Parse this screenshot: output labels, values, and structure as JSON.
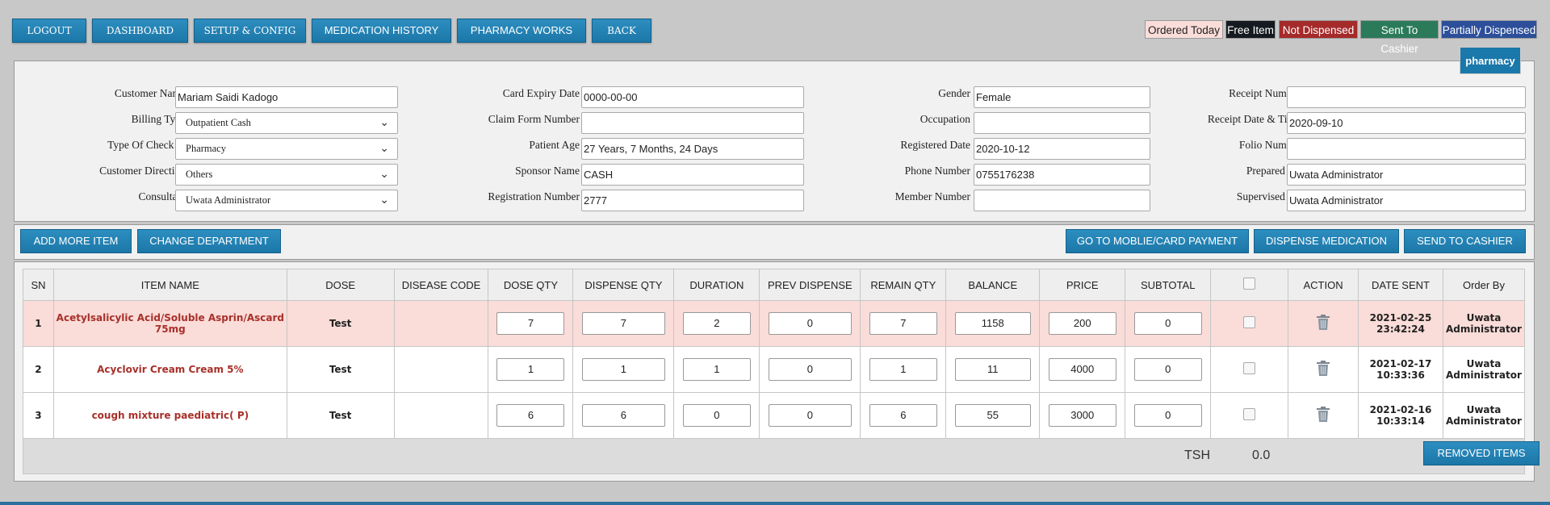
{
  "nav": {
    "logout": "LOGOUT",
    "dashboard": "DASHBOARD",
    "setup": "SETUP & CONFIG",
    "medication_history": "MEDICATION HISTORY",
    "pharmacy_works": "PHARMACY WORKS",
    "back": "BACK"
  },
  "legend": {
    "ordered_today": "Ordered Today",
    "free_item": "Free Item",
    "not_dispensed": "Not Dispensed",
    "sent_to_cashier": "Sent To Cashier",
    "partially_dispensed": "Partially Dispensed",
    "colors": {
      "ordered_today": "#fadcd8",
      "free_item": "#141a1f",
      "not_dispensed": "#a52a2a",
      "sent_to_cashier": "#2b7a5a",
      "partially_dispensed": "#2d4f9a"
    }
  },
  "pharmacy_button": "pharmacy",
  "form": {
    "customer_name_label": "Customer Name",
    "customer_name": "Mariam Saidi Kadogo",
    "billing_type_label": "Billing Type",
    "billing_type": "Outpatient Cash",
    "type_of_check_in_label": "Type Of Check In",
    "type_of_check_in": "Pharmacy",
    "customer_direction_label": "Customer Direction",
    "customer_direction": "Others",
    "consultant_label": "Consultant",
    "consultant": "Uwata Administrator",
    "card_expiry_label": "Card Expiry Date",
    "card_expiry": "0000-00-00",
    "claim_form_label": "Claim Form Number",
    "claim_form": "",
    "patient_age_label": "Patient Age",
    "patient_age": "27 Years, 7 Months, 24 Days",
    "sponsor_name_label": "Sponsor Name",
    "sponsor_name": "CASH",
    "registration_number_label": "Registration Number",
    "registration_number": "2777",
    "gender_label": "Gender",
    "gender": "Female",
    "occupation_label": "Occupation",
    "occupation": "",
    "registered_date_label": "Registered Date",
    "registered_date": "2020-10-12",
    "phone_label": "Phone Number",
    "phone": "0755176238",
    "member_number_label": "Member Number",
    "member_number": "",
    "receipt_number_label": "Receipt Number",
    "receipt_number": "",
    "receipt_datetime_label": "Receipt Date & Time",
    "receipt_datetime": "2020-09-10",
    "folio_label": "Folio Number",
    "folio": "",
    "prepared_by_label": "Prepared By",
    "prepared_by": "Uwata Administrator",
    "supervised_by_label": "Supervised By",
    "supervised_by": "Uwata Administrator"
  },
  "actions": {
    "add_more_item": "ADD MORE ITEM",
    "change_department": "CHANGE DEPARTMENT",
    "go_to_mobile": "GO TO MOBLIE/CARD PAYMENT",
    "dispense": "DISPENSE MEDICATION",
    "send_to_cashier": "SEND TO CASHIER"
  },
  "table": {
    "headers": [
      "SN",
      "ITEM NAME",
      "DOSE",
      "DISEASE CODE",
      "DOSE QTY",
      "DISPENSE QTY",
      "DURATION",
      "PREV DISPENSE",
      "REMAIN QTY",
      "BALANCE",
      "PRICE",
      "SUBTOTAL",
      "",
      "ACTION",
      "DATE SENT",
      "Order By"
    ],
    "rows": [
      {
        "sn": "1",
        "item": "Acetylsalicylic Acid/Soluble Asprin/Ascard 75mg",
        "dose": "Test",
        "disease_code": "",
        "dose_qty": "7",
        "dispense_qty": "7",
        "duration": "2",
        "prev_dispense": "0",
        "remain_qty": "7",
        "balance": "1158",
        "price": "200",
        "subtotal": "0",
        "date_sent": "2021-02-25 23:42:24",
        "order_by": "Uwata Administrator"
      },
      {
        "sn": "2",
        "item": "Acyclovir Cream Cream 5%",
        "dose": "Test",
        "disease_code": "",
        "dose_qty": "1",
        "dispense_qty": "1",
        "duration": "1",
        "prev_dispense": "0",
        "remain_qty": "1",
        "balance": "11",
        "price": "4000",
        "subtotal": "0",
        "date_sent": "2021-02-17 10:33:36",
        "order_by": "Uwata Administrator"
      },
      {
        "sn": "3",
        "item": "cough mixture paediatric( P)",
        "dose": "Test",
        "disease_code": "",
        "dose_qty": "6",
        "dispense_qty": "6",
        "duration": "0",
        "prev_dispense": "0",
        "remain_qty": "6",
        "balance": "55",
        "price": "3000",
        "subtotal": "0",
        "date_sent": "2021-02-16 10:33:14",
        "order_by": "Uwata Administrator"
      }
    ],
    "currency": "TSH",
    "total": "0.0",
    "removed_items": "REMOVED ITEMS"
  }
}
